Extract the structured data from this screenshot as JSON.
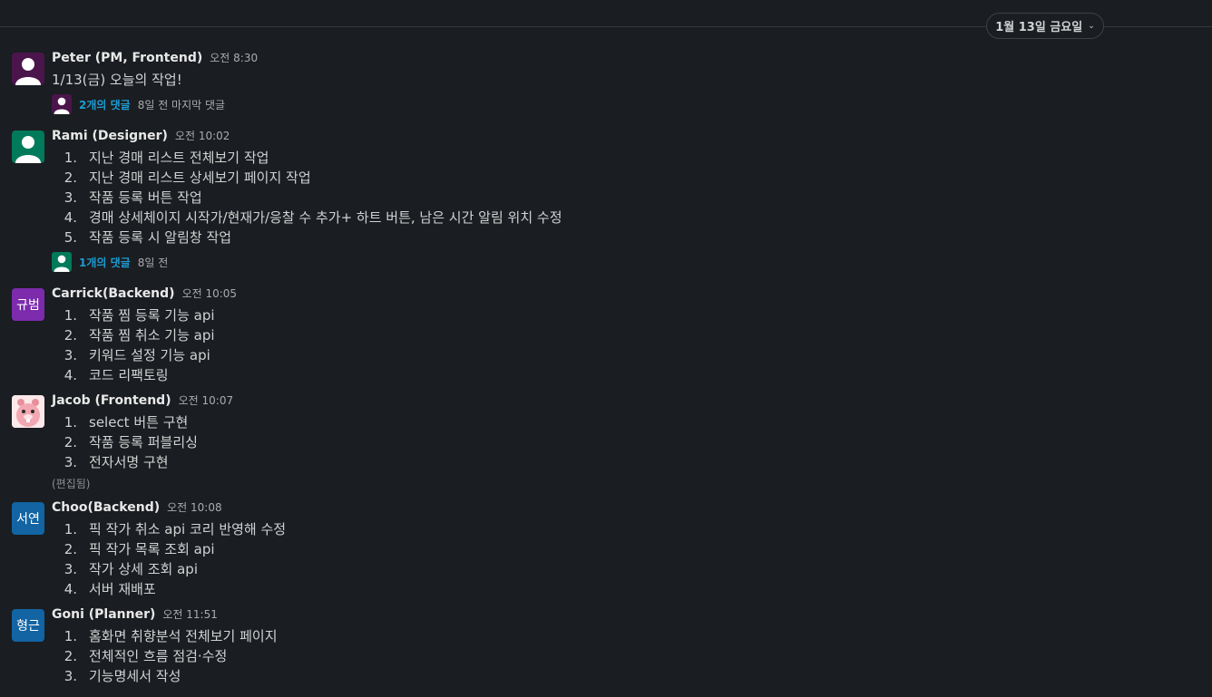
{
  "date_divider": {
    "label": "1월 13일 금요일"
  },
  "messages": [
    {
      "name": "Peter (PM, Frontend)",
      "time": "오전 8:30",
      "avatar_color": "#4a154b",
      "text": "1/13(금) 오늘의 작업!",
      "thread": {
        "count": "2개의 댓글",
        "when": "8일 전 마지막 댓글"
      }
    },
    {
      "name": "Rami (Designer)",
      "time": "오전 10:02",
      "avatar_color": "#007a5a",
      "items": [
        "지난 경매 리스트 전체보기 작업",
        "지난 경매 리스트 상세보기 페이지 작업",
        "작품 등록 버튼 작업",
        "경매 상세체이지 시작가/현재가/응찰 수 추가+ 하트 버튼, 남은 시간 알림 위치 수정",
        "작품 등록 시 알림창 작업"
      ],
      "thread": {
        "count": "1개의 댓글",
        "when": "8일 전"
      }
    },
    {
      "name": "Carrick(Backend)",
      "time": "오전 10:05",
      "avatar_text": "규범",
      "avatar_color": "#7c2bad",
      "items": [
        "작품 찜 등록 기능 api",
        "작품 찜 취소 기능 api",
        "키워드 설정 기능 api",
        "코드 리팩토링"
      ]
    },
    {
      "name": "Jacob (Frontend)",
      "time": "오전 10:07",
      "avatar_color": "#f7c6c7",
      "items": [
        "select 버튼 구현",
        "작품 등록 퍼블리싱",
        "전자서명 구현"
      ],
      "edited": "(편집됨)"
    },
    {
      "name": "Choo(Backend)",
      "time": "오전 10:08",
      "avatar_text": "서연",
      "avatar_color": "#1264a3",
      "items": [
        "픽 작가 취소 api 코리 반영해 수정",
        "픽 작가 목록 조회 api",
        "작가 상세 조회 api",
        "서버 재배포"
      ]
    },
    {
      "name": "Goni (Planner)",
      "time": "오전 11:51",
      "avatar_text": "형근",
      "avatar_color": "#1264a3",
      "items": [
        "홈화면 취향분석 전체보기 페이지",
        "전체적인 흐름 점검·수정",
        "기능명세서 작성"
      ]
    }
  ]
}
